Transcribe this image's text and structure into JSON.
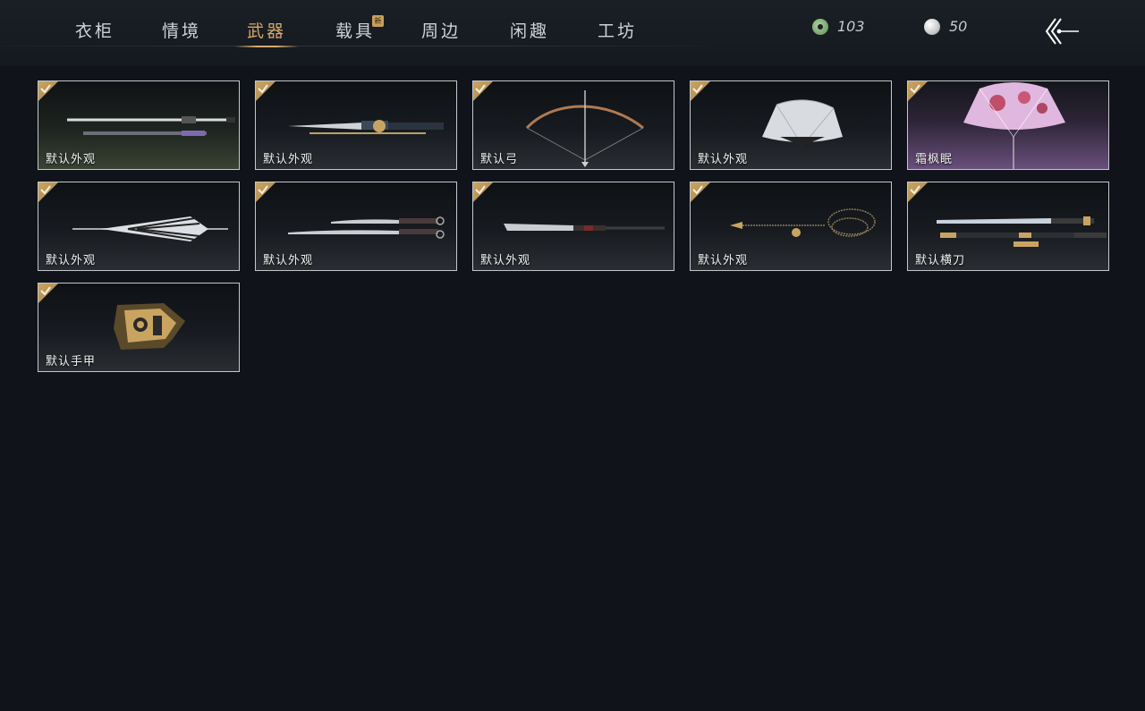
{
  "nav": {
    "tabs": [
      {
        "label": "衣柜"
      },
      {
        "label": "情境"
      },
      {
        "label": "武器",
        "active": true
      },
      {
        "label": "载具",
        "badge": "新"
      },
      {
        "label": "周边"
      },
      {
        "label": "闲趣"
      },
      {
        "label": "工坊"
      }
    ]
  },
  "currencies": [
    {
      "icon": "jade-coin-icon",
      "value": "103"
    },
    {
      "icon": "pearl-icon",
      "value": "50"
    }
  ],
  "back_icon": "back-arrow-icon",
  "items": [
    {
      "label": "默认外观",
      "icon": "spear-icon",
      "owned": true
    },
    {
      "label": "默认外观",
      "icon": "dual-blades-icon",
      "owned": true
    },
    {
      "label": "默认弓",
      "icon": "bow-icon",
      "owned": true
    },
    {
      "label": "默认外观",
      "icon": "folding-fan-icon",
      "owned": true
    },
    {
      "label": "霜枫眠",
      "icon": "maple-fan-icon",
      "owned": true
    },
    {
      "label": "默认外观",
      "icon": "umbrella-icon",
      "owned": true
    },
    {
      "label": "默认外观",
      "icon": "twin-sabres-icon",
      "owned": true
    },
    {
      "label": "默认外观",
      "icon": "glaive-icon",
      "owned": true
    },
    {
      "label": "默认外观",
      "icon": "rope-dart-icon",
      "owned": true
    },
    {
      "label": "默认横刀",
      "icon": "hengdao-icon",
      "owned": true
    },
    {
      "label": "默认手甲",
      "icon": "gauntlet-icon",
      "owned": true
    }
  ],
  "colors": {
    "accent": "#d6a86a",
    "background": "#10141a",
    "card_border": "#c4c7cb",
    "check_badge": "#c9a461"
  }
}
